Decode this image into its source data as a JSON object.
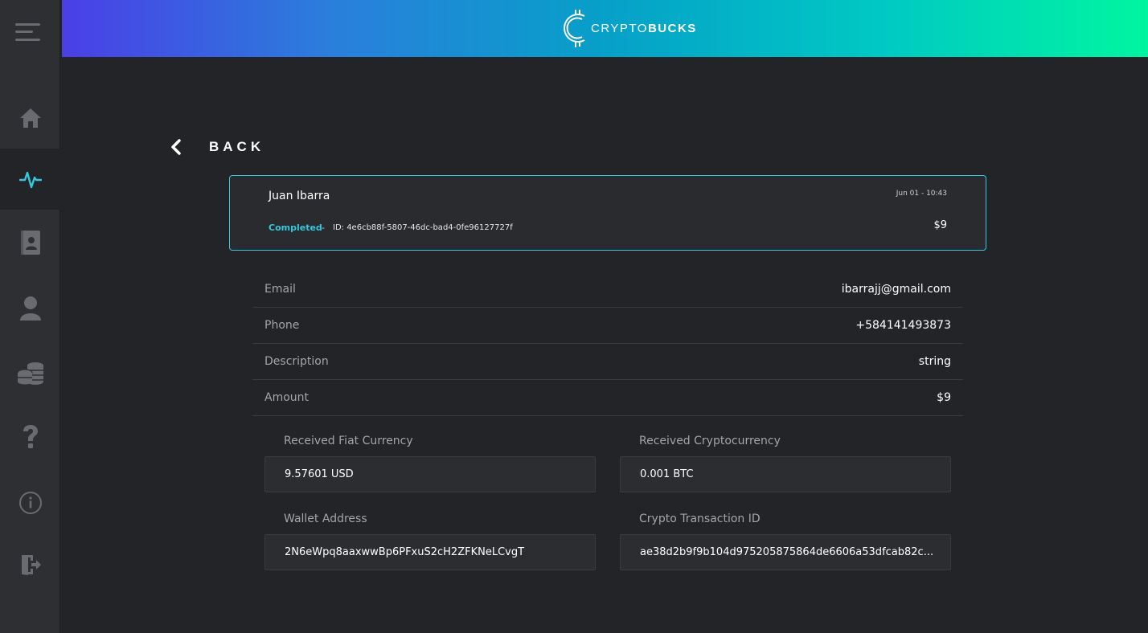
{
  "header": {
    "logo_text_light": "CRYPTO",
    "logo_text_bold": "BUCKS"
  },
  "sidebar": {
    "items": [
      {
        "icon": "home-icon",
        "active": false
      },
      {
        "icon": "activity-icon",
        "active": true
      },
      {
        "icon": "contacts-book-icon",
        "active": false
      },
      {
        "icon": "user-icon",
        "active": false
      },
      {
        "icon": "coins-icon",
        "active": false
      },
      {
        "icon": "help-icon",
        "active": false
      },
      {
        "icon": "info-icon",
        "active": false
      },
      {
        "icon": "logout-icon",
        "active": false
      }
    ]
  },
  "back": {
    "label": "BACK"
  },
  "transaction": {
    "name": "Juan Ibarra",
    "date": "Jun 01 - 10:43",
    "status": "Completed",
    "separator": "-",
    "id_text": "ID: 4e6cb88f-5807-46dc-bad4-0fe96127727f",
    "amount": "$9"
  },
  "details": [
    {
      "label": "Email",
      "value": "ibarrajj@gmail.com"
    },
    {
      "label": "Phone",
      "value": "+584141493873"
    },
    {
      "label": "Description",
      "value": "string"
    },
    {
      "label": "Amount",
      "value": "$9"
    }
  ],
  "fields": {
    "fiat": {
      "label": "Received Fiat Currency",
      "value": "9.57601 USD"
    },
    "crypto": {
      "label": "Received Cryptocurrency",
      "value": "0.001 BTC"
    },
    "wallet": {
      "label": "Wallet Address",
      "value": "2N6eWpq8aaxwwBp6PFxuS2cH2ZFKNeLCvgT"
    },
    "tx_id": {
      "label": "Crypto Transaction ID",
      "value": "ae38d2b9f9b104d975205875864de6606a53dfcab82c..."
    }
  },
  "colors": {
    "accent": "#36c7dc",
    "background": "#232427",
    "sidebar": "#2e2f33"
  }
}
